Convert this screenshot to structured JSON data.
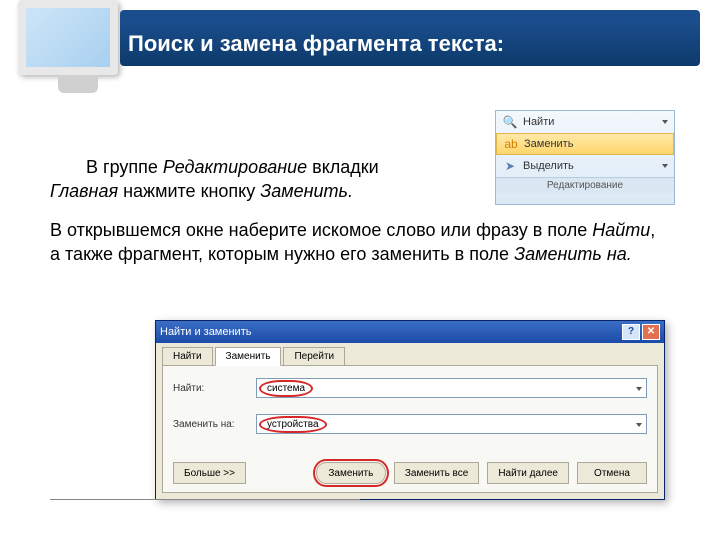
{
  "title": "Поиск и замена фрагмента текста:",
  "para1_1": "В группе ",
  "para1_em1": "Редактирование",
  "para1_2": " вкладки ",
  "para1_em2": "Главная",
  "para1_3": " нажмите кнопку ",
  "para1_em3": "Заменить.",
  "para2_1": "В открывшемся окне наберите искомое слово или фразу в поле ",
  "para2_em1": "Найти",
  "para2_2": ", а также фрагмент, которым нужно его заменить в поле ",
  "para2_em2": "Заменить на.",
  "ribbon": {
    "find": "Найти",
    "replace": "Заменить",
    "select": "Выделить",
    "caption": "Редактирование"
  },
  "dialog": {
    "title": "Найти и заменить",
    "help": "?",
    "close": "✕",
    "tab_find": "Найти",
    "tab_replace": "Заменить",
    "tab_goto": "Перейти",
    "label_find": "Найти:",
    "value_find": "система",
    "label_replace": "Заменить на:",
    "value_replace": "устройства",
    "btn_more": "Больше >>",
    "btn_replace": "Заменить",
    "btn_replace_all": "Заменить все",
    "btn_find_next": "Найти далее",
    "btn_cancel": "Отмена"
  }
}
